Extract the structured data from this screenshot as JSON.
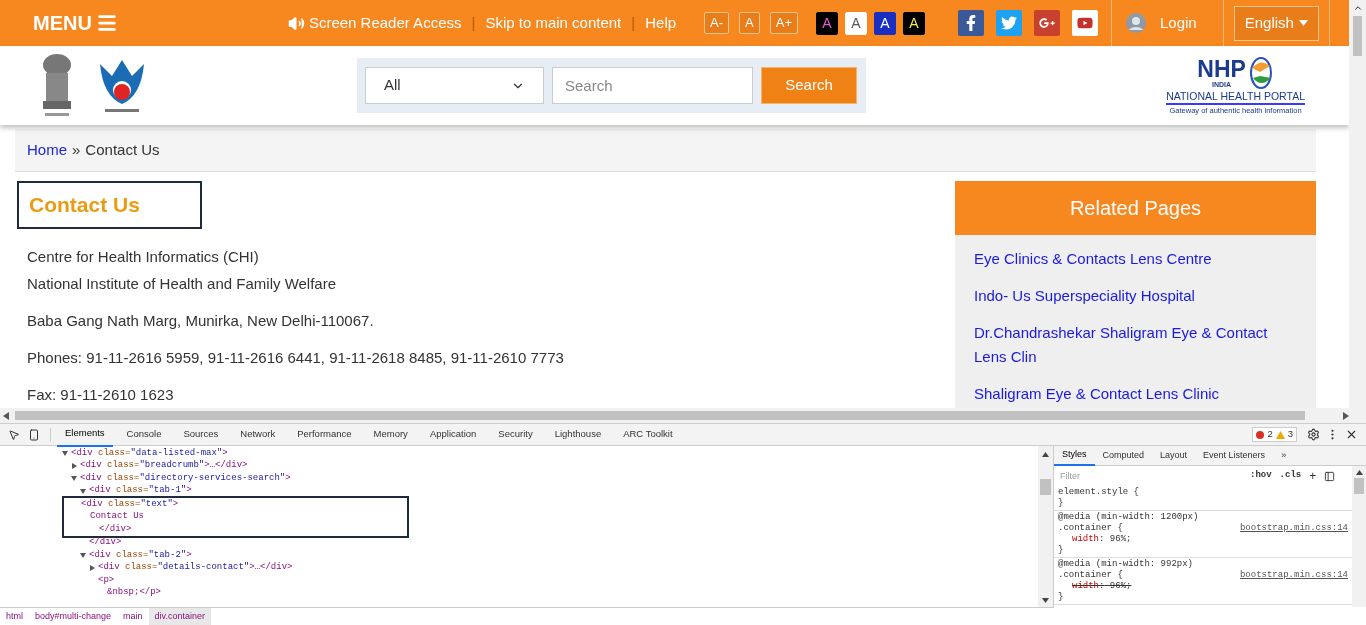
{
  "top_bar": {
    "menu_label": "MENU",
    "links": [
      {
        "label": "Screen Reader Access",
        "kind": "speaker"
      },
      {
        "label": "Skip to main content",
        "kind": "plain"
      },
      {
        "label": "Help",
        "kind": "plain"
      }
    ],
    "separator": "|",
    "font_buttons": [
      "A-",
      "A",
      "A+"
    ],
    "contrast_buttons": [
      {
        "label": "A",
        "kind": "dark-pink"
      },
      {
        "label": "A",
        "kind": "light"
      },
      {
        "label": "A",
        "kind": "blue"
      },
      {
        "label": "A",
        "kind": "dark-yellow"
      }
    ],
    "social": [
      {
        "kind": "facebook"
      },
      {
        "kind": "twitter"
      },
      {
        "kind": "googleplus"
      },
      {
        "kind": "youtube"
      }
    ],
    "login": "Login",
    "language": "English"
  },
  "header": {
    "category": "All",
    "search_placeholder": "Search",
    "search_button": "Search",
    "portal_logo": {
      "acronym": "NHP",
      "country": "INDIA",
      "name": "NATIONAL HEALTH PORTAL",
      "tagline": "Gateway of authentic health information"
    }
  },
  "breadcrumb": {
    "home": "Home",
    "separator": "»",
    "current": "Contact Us"
  },
  "contact": {
    "heading": "Contact Us",
    "heading_outlined": true,
    "lines": [
      "Centre for Health Informatics (CHI)",
      "National Institute of Health and Family Welfare"
    ],
    "paragraphs": [
      "Baba Gang Nath Marg, Munirka, New Delhi-110067.",
      "Phones: 91-11-2616 5959, 91-11-2616 6441, 91-11-2618 8485, 91-11-2610 7773",
      "Fax: 91-11-2610 1623"
    ]
  },
  "related": {
    "title": "Related Pages",
    "links": [
      "Eye Clinics & Contacts Lens Centre",
      "Indo- Us Superspeciality Hospital",
      "Dr.Chandrashekar Shaligram Eye & Contact Lens Clin",
      "Shaligram Eye & Contact Lens Clinic"
    ]
  },
  "devtools": {
    "tabs": [
      {
        "label": "Elements",
        "selected": true
      },
      {
        "label": "Console",
        "selected": false
      },
      {
        "label": "Sources",
        "selected": false
      },
      {
        "label": "Network",
        "selected": false
      },
      {
        "label": "Performance",
        "selected": false
      },
      {
        "label": "Memory",
        "selected": false
      },
      {
        "label": "Application",
        "selected": false
      },
      {
        "label": "Security",
        "selected": false
      },
      {
        "label": "Lighthouse",
        "selected": false
      },
      {
        "label": "ARC Toolkit",
        "selected": false
      }
    ],
    "errors": "2",
    "warnings": "3",
    "dom": [
      {
        "text": "<div class=\"data-listed-max\">",
        "expanded": true,
        "children": [
          {
            "text": "<div class=\"breadcrumb\">…</div>",
            "expanded": false
          },
          {
            "text": "<div class=\"directory-services-search\">",
            "expanded": true,
            "children": [
              {
                "text": "<div class=\"tab-1\">",
                "expanded": true,
                "children": [
                  {
                    "kind": "box",
                    "children": [
                      {
                        "text": "<div class=\"text\">",
                        "children": [
                          {
                            "text": "Contact Us",
                            "children": [
                              {
                                "text": "</div>"
                              }
                            ]
                          }
                        ]
                      }
                    ]
                  }
                ]
              },
              {
                "text": "</div>"
              },
              {
                "text": "<div class=\"tab-2\">",
                "expanded": true,
                "children": [
                  {
                    "text": "<div class=\"details-contact\">…</div>",
                    "expanded": false
                  },
                  {
                    "text": "<p>",
                    "children": [
                      {
                        "text": "&nbsp;</p>"
                      }
                    ]
                  }
                ]
              }
            ]
          }
        ]
      }
    ],
    "path": [
      {
        "label": "html",
        "selected": false
      },
      {
        "label": "body#multi-change",
        "selected": false
      },
      {
        "label": "main",
        "selected": false
      },
      {
        "label": "div.container",
        "selected": true
      }
    ],
    "styles_tabs": [
      {
        "label": "Styles",
        "selected": true
      },
      {
        "label": "Computed",
        "selected": false
      },
      {
        "label": "Layout",
        "selected": false
      },
      {
        "label": "Event Listeners",
        "selected": false
      }
    ],
    "more_tabs": "»",
    "filter_placeholder": "Filter",
    "hov": ":hov",
    "cls": ".cls",
    "add": "+",
    "declaration_separator": ":",
    "rules": [
      {
        "selector": "element.style {",
        "close": "}"
      },
      {
        "media": "@media (min-width: 1200px)",
        "selector": ".container {",
        "source": "bootstrap.min.css:14",
        "declarations": [
          {
            "property": "width",
            "value": "96%;",
            "overridden": false
          }
        ],
        "close": "}"
      },
      {
        "media": "@media (min-width: 992px)",
        "selector": ".container {",
        "source": "bootstrap.min.css:14",
        "declarations": [
          {
            "property": "width",
            "value": "96%;",
            "overridden": true
          }
        ],
        "close": "}"
      }
    ]
  }
}
